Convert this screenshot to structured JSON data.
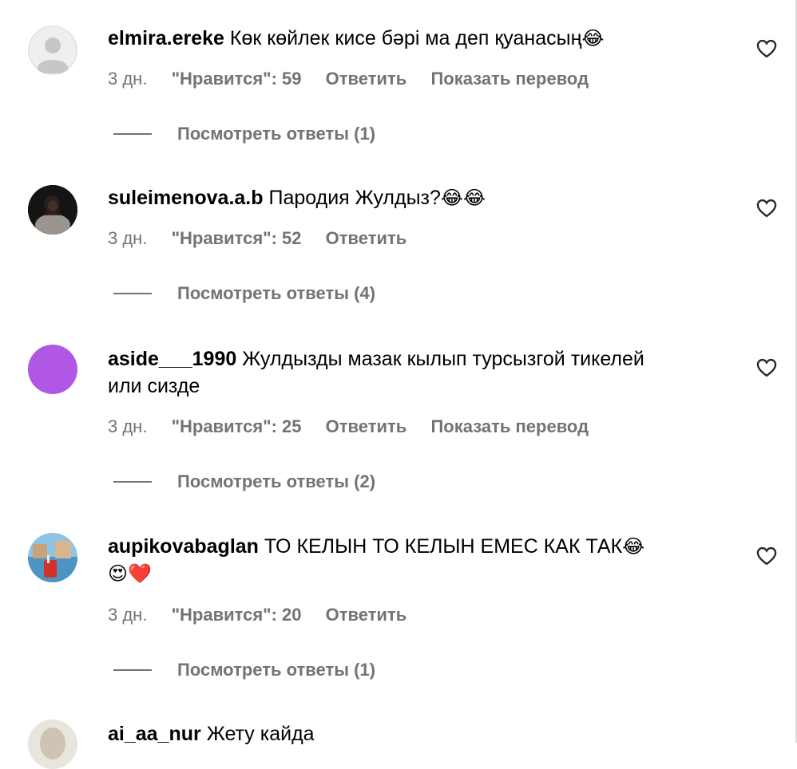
{
  "comments": [
    {
      "username": "elmira.ereke",
      "text": "Көк көйлек кисе бәрі ма деп қуанасың",
      "emoji": "😂",
      "time": "3 дн.",
      "likes": "\"Нравится\": 59",
      "reply": "Ответить",
      "translate": "Показать перевод",
      "view_replies": "Посмотреть ответы (1)",
      "avatar_color": "#dbdbdb"
    },
    {
      "username": "suleimenova.a.b",
      "text": "Пародия Жулдыз?",
      "emoji": "😂😂",
      "time": "3 дн.",
      "likes": "\"Нравится\": 52",
      "reply": "Ответить",
      "view_replies": "Посмотреть ответы (4)",
      "avatar_color": "#222222"
    },
    {
      "username": "aside___1990",
      "text": "Жулдызды мазак кылып турсызгой тикелей или сизде",
      "time": "3 дн.",
      "likes": "\"Нравится\": 25",
      "reply": "Ответить",
      "translate": "Показать перевод",
      "view_replies": "Посмотреть ответы (2)",
      "avatar_color": "#b057e6"
    },
    {
      "username": "aupikovabaglan",
      "text": "ТО КЕЛЫН ТО КЕЛЫН ЕМЕС КАК ТАК",
      "emoji": "😂",
      "emoji2": "😍❤️",
      "time": "3 дн.",
      "likes": "\"Нравится\": 20",
      "reply": "Ответить",
      "view_replies": "Посмотреть ответы (1)",
      "avatar_color": "#6aa9d8"
    }
  ],
  "partial": {
    "username": "ai_aa_nur",
    "text": "Жету кайда"
  },
  "colors": {
    "secondary_text": "#737373",
    "divider": "#dbdbdb"
  }
}
